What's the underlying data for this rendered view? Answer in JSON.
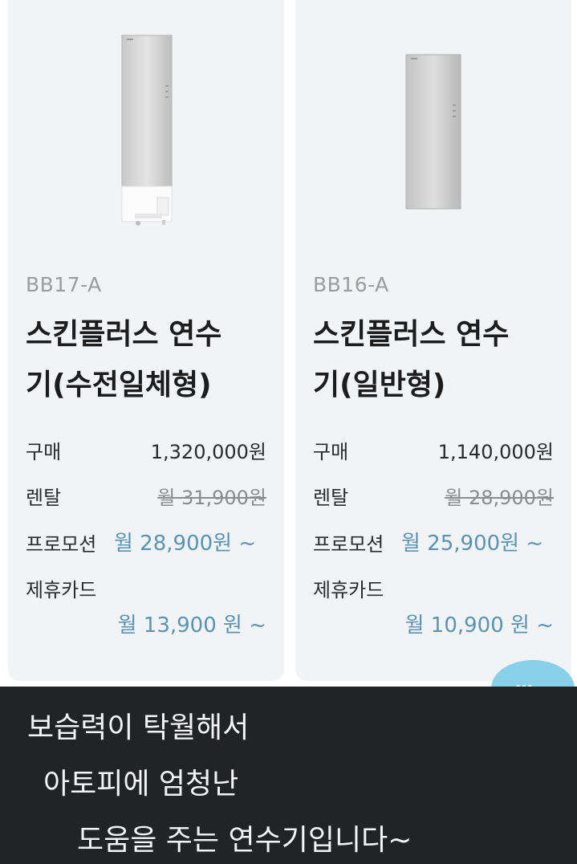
{
  "products": [
    {
      "model": "BB17-A",
      "name_line1": "스킨플러스 연수",
      "name_line2": "기(수전일체형)",
      "purchase_label": "구매",
      "purchase_price": "1,320,000원",
      "rental_label": "렌탈",
      "rental_price": "월 31,900원",
      "promo_label": "프로모션",
      "promo_price": "월 28,900원 ~",
      "card_label": "제휴카드",
      "card_price": "월 13,900 원 ~"
    },
    {
      "model": "BB16-A",
      "name_line1": "스킨플러스 연수",
      "name_line2": "기(일반형)",
      "purchase_label": "구매",
      "purchase_price": "1,140,000원",
      "rental_label": "렌탈",
      "rental_price": "월 28,900원",
      "promo_label": "프로모션",
      "promo_price": "월 25,900원 ~",
      "card_label": "제휴카드",
      "card_price": "월 10,900 원 ~"
    }
  ],
  "caption": {
    "line1": "보습력이 탁월해서",
    "line2": "아토피에 엄청난",
    "line3": "도움을 주는 연수기입니다~"
  },
  "colors": {
    "accent_blue": "#5a93b3",
    "card_bg": "#f2f3f5",
    "caption_bg": "#222325",
    "fab": "#89d0ea"
  }
}
